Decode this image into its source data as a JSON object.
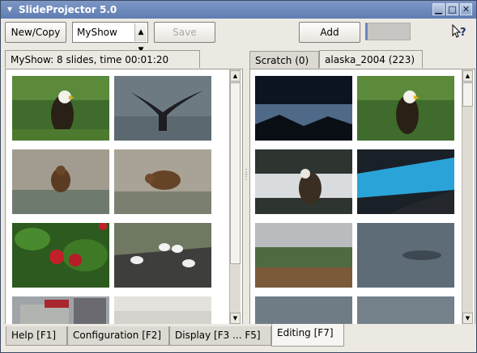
{
  "window": {
    "title": "SlideProjector 5.0"
  },
  "toolbar": {
    "new_copy_label": "New/Copy",
    "show_select_value": "MyShow",
    "save_label": "Save",
    "add_label": "Add"
  },
  "left_panel": {
    "tab_label": "MyShow: 8 slides, time 00:01:20",
    "thumbnails": [
      "eagle",
      "whale-tail",
      "bear-1",
      "bear-2",
      "raspberries",
      "gulls",
      "village",
      "bright"
    ]
  },
  "right_panel": {
    "tabs": [
      {
        "label": "Scratch (0)"
      },
      {
        "label": "alaska_2004 (223)"
      }
    ],
    "thumbnails": [
      "night-sea",
      "eagle",
      "eagle-waterfall",
      "glacier",
      "meadow",
      "whale-water",
      "sea-strip-1",
      "sea-strip-2"
    ]
  },
  "bottom_tabs": [
    {
      "label": "Help [F1]"
    },
    {
      "label": "Configuration [F2]"
    },
    {
      "label": "Display [F3 ... F5]"
    },
    {
      "label": "Editing [F7]"
    }
  ]
}
